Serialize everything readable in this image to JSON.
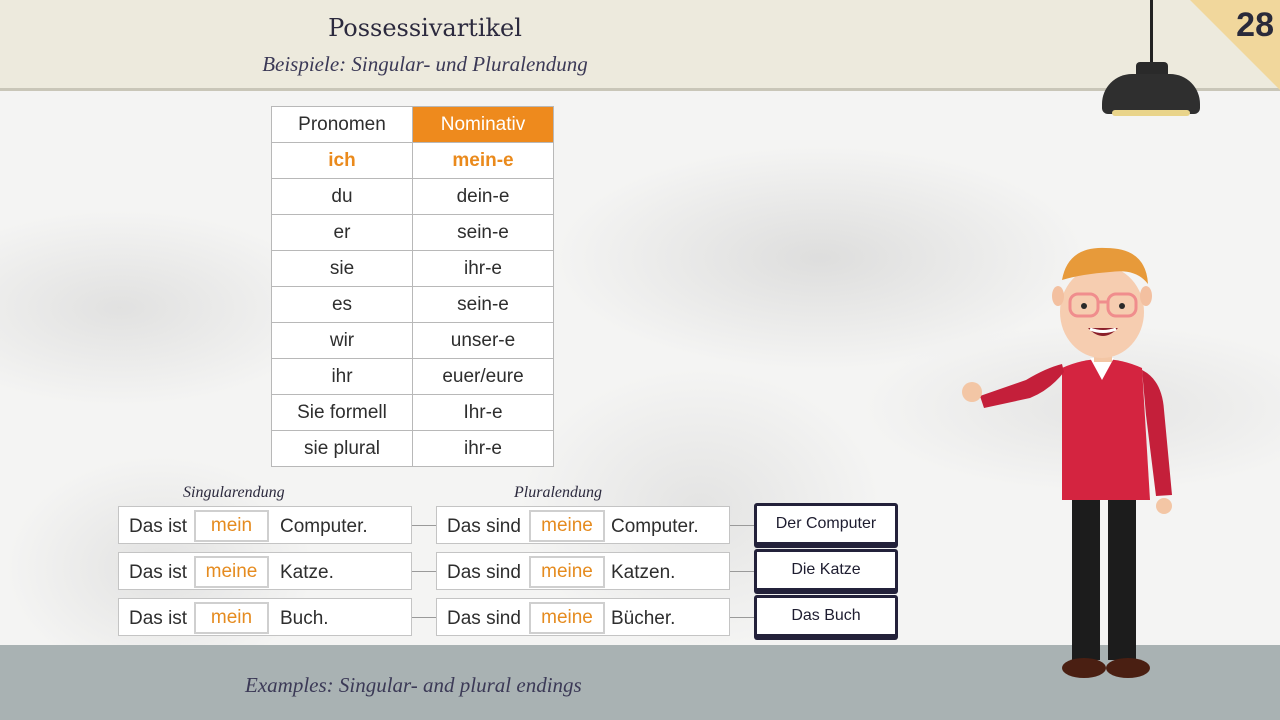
{
  "header": {
    "title": "Possessivartikel",
    "subtitle": "Beispiele: Singular- und Pluralendung",
    "page_number": "28"
  },
  "table": {
    "headers": [
      "Pronomen",
      "Nominativ"
    ],
    "rows": [
      [
        "ich",
        "mein-e"
      ],
      [
        "du",
        "dein-e"
      ],
      [
        "er",
        "sein-e"
      ],
      [
        "sie",
        "ihr-e"
      ],
      [
        "es",
        "sein-e"
      ],
      [
        "wir",
        "unser-e"
      ],
      [
        "ihr",
        "euer/eure"
      ],
      [
        "Sie formell",
        "Ihr-e"
      ],
      [
        "sie plural",
        "ihr-e"
      ]
    ]
  },
  "examples": {
    "singular_label": "Singularendung",
    "plural_label": "Pluralendung",
    "singular": [
      {
        "start": "Das ist",
        "article": "mein",
        "noun": "Computer."
      },
      {
        "start": "Das ist",
        "article": "meine",
        "noun": "Katze."
      },
      {
        "start": "Das ist",
        "article": "mein",
        "noun": "Buch."
      }
    ],
    "plural": [
      {
        "start": "Das sind",
        "article": "meine",
        "noun": "Computer."
      },
      {
        "start": "Das sind",
        "article": "meine",
        "noun": "Katzen."
      },
      {
        "start": "Das sind",
        "article": "meine",
        "noun": "Bücher."
      }
    ],
    "nouns": [
      "Der Computer",
      "Die Katze",
      "Das Buch"
    ]
  },
  "footer": {
    "text": "Examples: Singular- and plural endings"
  },
  "colors": {
    "accent": "#ee8a1d",
    "header_bg": "#edeadd",
    "footer_bg": "#a9b2b3",
    "corner": "#f1d79c"
  }
}
